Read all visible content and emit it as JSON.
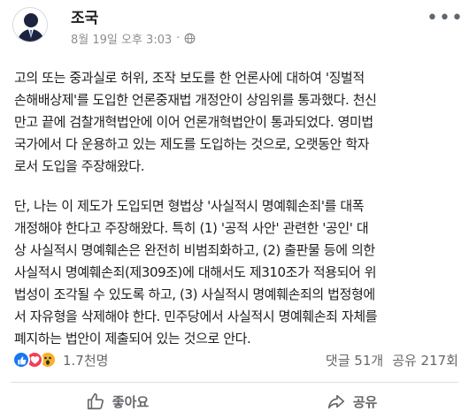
{
  "post": {
    "author": "조국",
    "timestamp": "8월 19일 오후 3:03",
    "separator": "·",
    "privacy_icon": "globe-icon",
    "more_label": "•••",
    "paragraphs": [
      "고의 또는 중과실로 허위, 조작 보도를 한 언론사에 대하여 '징벌적\n손해배상제'를 도입한 언론중재법 개정안이 상임위를 통과했다. 천신\n만고 끝에 검찰개혁법안에 이어 언론개혁법안이 통과되었다. 영미법\n국가에서 다 운용하고 있는 제도를 도입하는 것으로, 오랫동안 학자\n로서 도입을 주장해왔다.",
      "단, 나는 이 제도가 도입되면 형법상 '사실적시 명예훼손죄'를 대폭\n개정해야 한다고 주장해왔다. 특히 (1) '공적 사안' 관련한 '공인' 대\n상 사실적시 명예훼손은 완전히 비범죄화하고, (2) 출판물 등에 의한\n사실적시 명예훼손죄(제309조)에 대해서도 제310조가 적용되어 위\n법성이 조각될 수 있도록 하고, (3) 사실적시 명예훼손죄의 법정형에\n서 자유형을 삭제해야 한다. 민주당에서 사실적시 명예훼손죄 자체를\n폐지하는 법안이 제출되어 있는 것으로 안다."
    ]
  },
  "reactions": {
    "icons": [
      "like-icon",
      "love-icon",
      "wow-icon"
    ],
    "count": "1.7천명",
    "comments": "댓글 51개",
    "shares": "공유 217회"
  },
  "actions": {
    "like_label": "좋아요",
    "share_label": "공유"
  },
  "colors": {
    "like_blue": "#1877f2",
    "love_red": "#f33e58",
    "wow_yellow": "#f7b125",
    "muted_text": "#65676b"
  }
}
